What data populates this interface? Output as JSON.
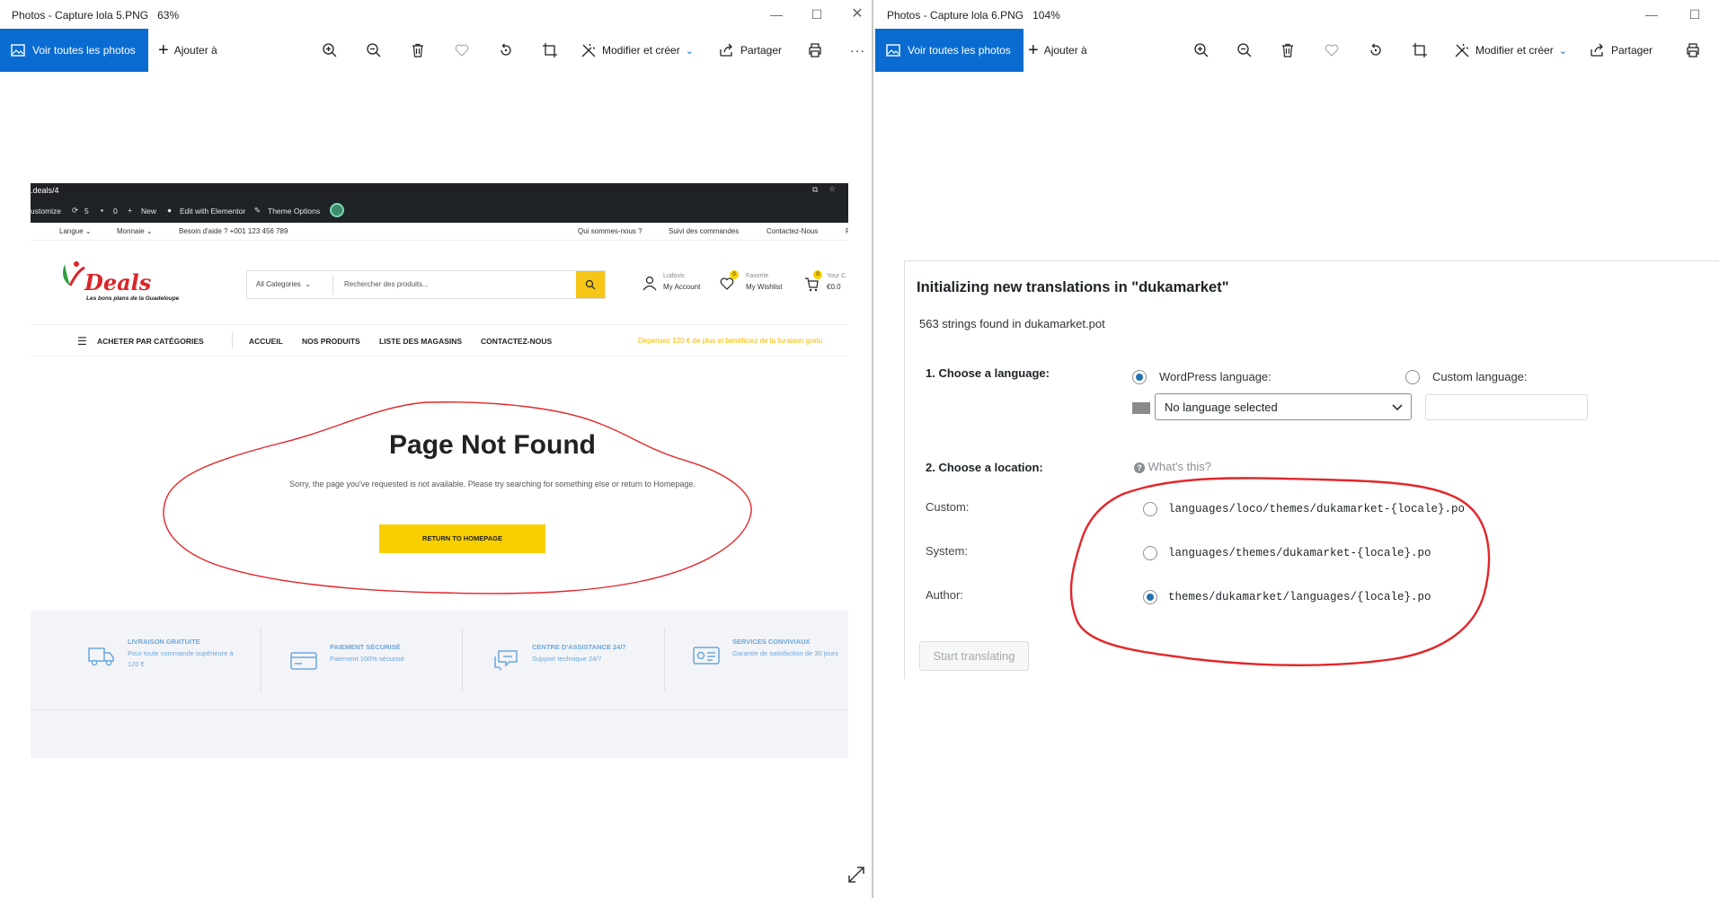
{
  "left_window": {
    "title": "Photos - Capture lola 5.PNG",
    "zoom": "63%",
    "toolbar": {
      "view_all": "Voir toutes les photos",
      "add_to": "Ajouter à",
      "edit_create": "Modifier et créer",
      "share": "Partager",
      "more": "···"
    },
    "site": {
      "url_fragment": ".deals/4",
      "admin_bar": {
        "customize": "ustomize",
        "updates": "5",
        "comments": "0",
        "new": "New",
        "edit_elementor": "Edit with Elementor",
        "theme_options": "Theme Options"
      },
      "topbar": {
        "language": "Langue",
        "currency": "Monnaie",
        "help": "Besoin d'aide ? +001 123 456 789",
        "about": "Qui sommes-nous ?",
        "orders": "Suivi des commandes",
        "contact": "Contactez-Nous",
        "cut": "F"
      },
      "logo": {
        "name": "Deals",
        "tagline": "Les bons plans de la Guadeloupe"
      },
      "search": {
        "category": "All Categories",
        "placeholder": "Rechercher des produits..."
      },
      "account": {
        "user": "Ludovic",
        "label": "My Account"
      },
      "wishlist": {
        "top": "Favorite",
        "label": "My Wishlist",
        "count": "0"
      },
      "cart": {
        "top": "Your C",
        "label": "€0.0",
        "count": "0"
      },
      "nav": {
        "categories": "ACHETER PAR CATÉGORIES",
        "home": "ACCUEIL",
        "products": "NOS PRODUITS",
        "stores": "LISTE DES MAGASINS",
        "contact": "CONTACTEZ-NOUS",
        "promo": "Dépensez 120 € de plus et bénéficiez de la livraison gratu"
      },
      "not_found": {
        "title": "Page Not Found",
        "message": "Sorry, the page you've requested is not available. Please try searching for something else or return to Homepage.",
        "button": "RETURN TO HOMEPAGE"
      },
      "features": [
        {
          "title": "LIVRAISON GRATUITE",
          "desc": "Pour toute commande supérieure à 120 €"
        },
        {
          "title": "PAIEMENT SÉCURISÉ",
          "desc": "Paiement 100% sécurisé"
        },
        {
          "title": "CENTRE D'ASSISTANCE 24/7",
          "desc": "Support technique 24/7"
        },
        {
          "title": "SERVICES CONVIVIAUX",
          "desc": "Garantie de satisfaction de 30 jours"
        }
      ]
    }
  },
  "right_window": {
    "title": "Photos - Capture lola 6.PNG",
    "zoom": "104%",
    "toolbar": {
      "view_all": "Voir toutes les photos",
      "add_to": "Ajouter à",
      "edit_create": "Modifier et créer",
      "share": "Partager"
    },
    "panel": {
      "heading": "Initializing new translations in \"dukamarket\"",
      "subtitle": "563 strings found in dukamarket.pot",
      "step1": "1. Choose a language:",
      "wp_language": "WordPress language:",
      "custom_language": "Custom language:",
      "language_select": "No language selected",
      "step2": "2. Choose a location:",
      "whats_this": "What's this?",
      "locations": [
        {
          "label": "Custom:",
          "path": "languages/loco/themes/dukamarket-{locale}.po",
          "selected": false
        },
        {
          "label": "System:",
          "path": "languages/themes/dukamarket-{locale}.po",
          "selected": false
        },
        {
          "label": "Author:",
          "path": "themes/dukamarket/languages/{locale}.po",
          "selected": true
        }
      ],
      "start_button": "Start translating"
    }
  },
  "colors": {
    "accent": "#0a6cd1",
    "annotation": "#e3262a",
    "yellow": "#f8d000",
    "wp_blue": "#2271b1"
  }
}
